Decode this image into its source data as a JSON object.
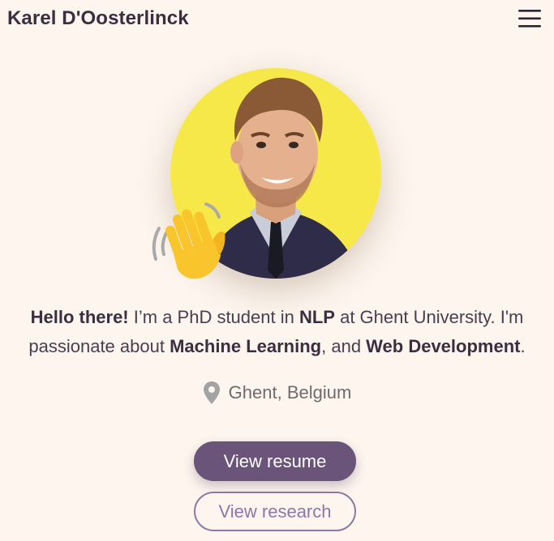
{
  "header": {
    "title": "Karel D'Oosterlinck",
    "menu_icon": "hamburger-menu-icon"
  },
  "hero": {
    "avatar_icon": "profile-photo",
    "wave_icon": "waving-hand-emoji",
    "colors": {
      "avatar_background": "#f7e84a",
      "wave_hand": "#f9c52d"
    }
  },
  "intro": {
    "greeting": "Hello there!",
    "text_1": " I’m a PhD student in ",
    "field": "NLP",
    "text_2": " at Ghent University. I'm passionate about ",
    "interest_1": "Machine Learning",
    "text_3": ", and ",
    "interest_2": "Web Development",
    "text_4": "."
  },
  "location": {
    "icon": "map-pin-icon",
    "text": "Ghent, Belgium"
  },
  "buttons": {
    "resume": "View resume",
    "research": "View research"
  },
  "colors": {
    "background": "#fdf5ee",
    "primary": "#6a5479",
    "secondary": "#8f76a6"
  }
}
